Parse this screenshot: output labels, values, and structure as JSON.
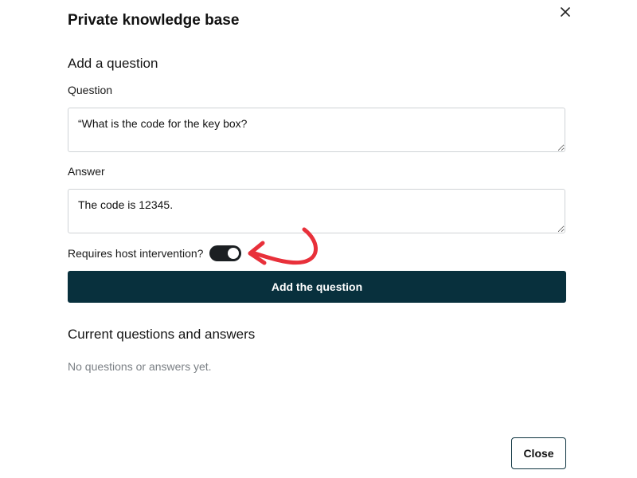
{
  "dialog": {
    "title": "Private knowledge base",
    "close_icon": "close-icon"
  },
  "add_section": {
    "heading": "Add a question",
    "question_label": "Question",
    "question_value": "“What is the code for the key box?",
    "answer_label": "Answer",
    "answer_value": "The code is 12345.",
    "toggle_label": "Requires host intervention?",
    "toggle_on": true,
    "submit_label": "Add the question"
  },
  "current_section": {
    "heading": "Current questions and answers",
    "empty_text": "No questions or answers yet."
  },
  "footer": {
    "close_label": "Close"
  },
  "colors": {
    "primary_button": "#08303d",
    "toggle_on": "#1b1f22",
    "annotation_arrow": "#e8303a",
    "muted_text": "#7a7f84"
  }
}
